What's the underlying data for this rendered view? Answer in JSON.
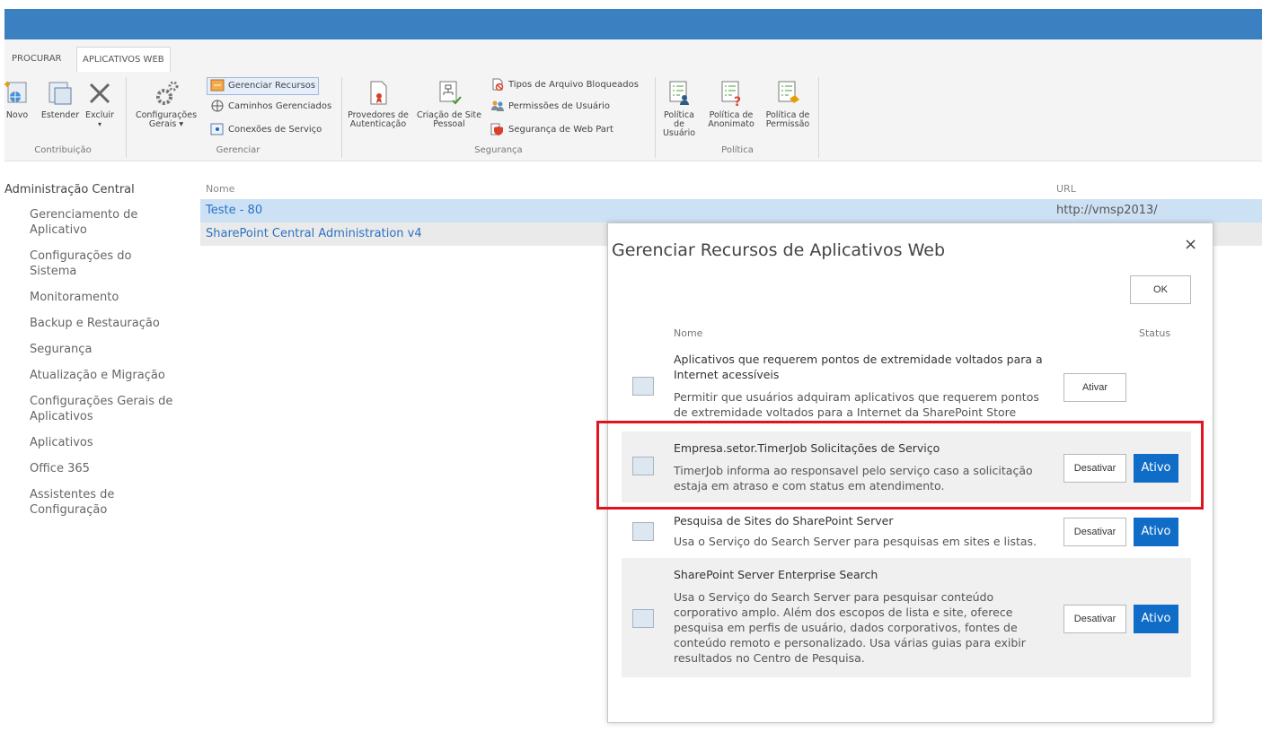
{
  "ribbon": {
    "tabs": [
      "PROCURAR",
      "APLICATIVOS WEB"
    ],
    "contribuicao": {
      "label": "Contribuição",
      "novo": "Novo",
      "estender": "Estender",
      "excluir": "Excluir",
      "excluir_arrow": "▾"
    },
    "gerenciar": {
      "label": "Gerenciar",
      "config_line1": "Configurações",
      "config_line2": "Gerais ▾",
      "gerenciar_recursos": "Gerenciar Recursos",
      "caminhos": "Caminhos Gerenciados",
      "conexoes": "Conexões de Serviço"
    },
    "seguranca": {
      "label": "Segurança",
      "provedores_line1": "Provedores de",
      "provedores_line2": "Autenticação",
      "criacao_line1": "Criação de Site",
      "criacao_line2": "Pessoal",
      "tipos": "Tipos de Arquivo Bloqueados",
      "permissoes": "Permissões de Usuário",
      "seg_webpart": "Segurança de Web Part"
    },
    "politica": {
      "label": "Política",
      "usuario_line1": "Política de",
      "usuario_line2": "Usuário",
      "anonimato_line1": "Política de",
      "anonimato_line2": "Anonimato",
      "permissao_line1": "Política de",
      "permissao_line2": "Permissão"
    }
  },
  "leftnav": {
    "heading": "Administração Central",
    "items": [
      "Gerenciamento de Aplicativo",
      "Configurações do Sistema",
      "Monitoramento",
      "Backup e Restauração",
      "Segurança",
      "Atualização e Migração",
      "Configurações Gerais de Aplicativos",
      "Aplicativos",
      "Office 365",
      "Assistentes de Configuração"
    ]
  },
  "list": {
    "col_name": "Nome",
    "col_url": "URL",
    "rows": [
      {
        "name": "Teste - 80",
        "url": "http://vmsp2013/"
      },
      {
        "name": "SharePoint Central Administration v4",
        "url": ""
      }
    ]
  },
  "dialog": {
    "title": "Gerenciar Recursos de Aplicativos Web",
    "close": "×",
    "ok": "OK",
    "col_name": "Nome",
    "col_status": "Status",
    "features": [
      {
        "name": "Aplicativos que requerem pontos de extremidade voltados para a Internet acessíveis",
        "desc": "Permitir que usuários adquiram aplicativos que requerem pontos de extremidade voltados para a Internet da SharePoint Store",
        "button": "Ativar",
        "status": ""
      },
      {
        "name": "Empresa.setor.TimerJob Solicitações de Serviço",
        "desc": "TimerJob informa ao responsavel pelo serviço caso a solicitação estaja em atraso e com status em atendimento.",
        "button": "Desativar",
        "status": "Ativo"
      },
      {
        "name": "Pesquisa de Sites do SharePoint Server",
        "desc": "Usa o Serviço do Search Server para pesquisas em sites e listas.",
        "button": "Desativar",
        "status": "Ativo"
      },
      {
        "name": "SharePoint Server Enterprise Search",
        "desc": "Usa o Serviço do Search Server para pesquisar conteúdo corporativo amplo. Além dos escopos de lista e site, oferece pesquisa em perfis de usuário, dados corporativos, fontes de conteúdo remoto e personalizado. Usa várias guias para exibir resultados no Centro de Pesquisa.",
        "button": "Desativar",
        "status": "Ativo"
      }
    ]
  },
  "colors": {
    "suitebar": "#3b80c0",
    "accent": "#0f6cc7",
    "highlight": "#e0141e",
    "link": "#2b72c4"
  }
}
